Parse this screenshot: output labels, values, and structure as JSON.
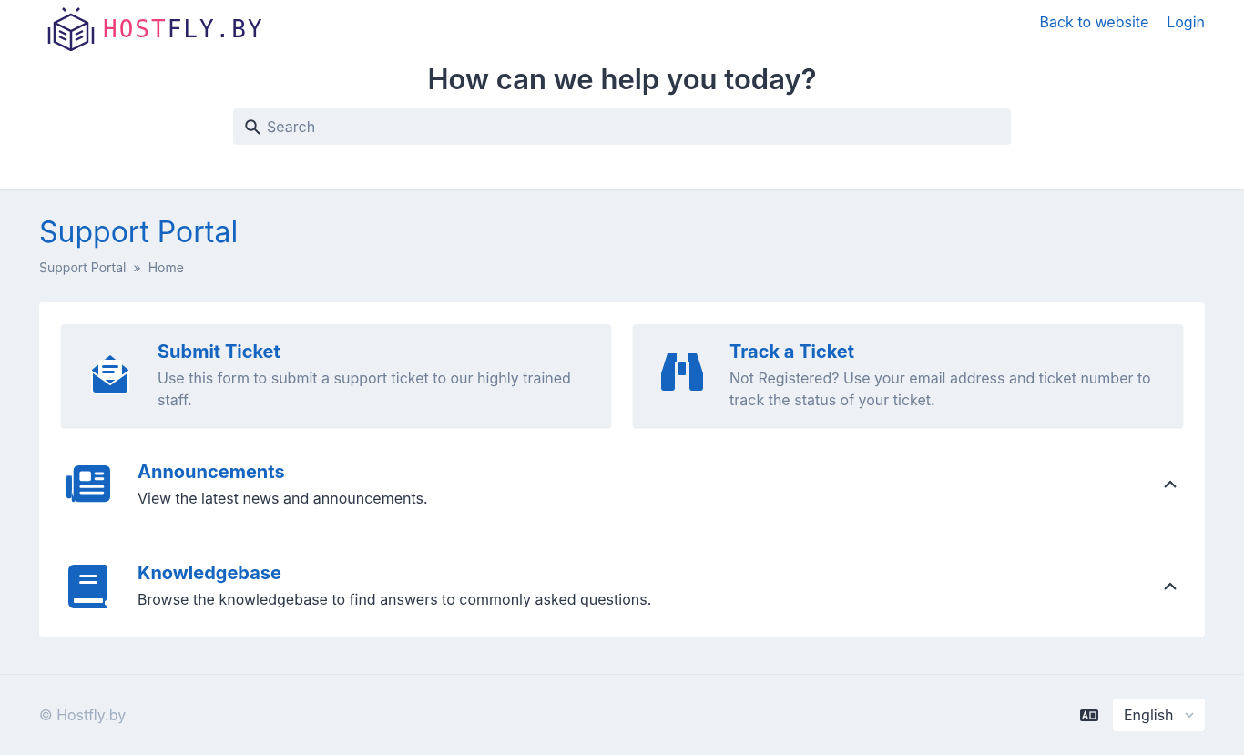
{
  "header": {
    "logo": {
      "part_1": "HOST",
      "part_2": "FLY.BY"
    },
    "nav": [
      "Back to website",
      "Login"
    ],
    "heading": "How can we help you today?",
    "search": {
      "placeholder": "Search"
    }
  },
  "page": {
    "title": "Support Portal",
    "breadcrumb": [
      {
        "label": "Support Portal"
      },
      {
        "label": "Home"
      }
    ],
    "breadcrumb_separator": "»"
  },
  "cards": [
    {
      "kind": "ticket",
      "title": "Submit Ticket",
      "description": "Use this form to submit a support ticket to our highly trained staff."
    },
    {
      "kind": "track",
      "title": "Track a Ticket",
      "description": "Not Registered? Use your email address and ticket number to track the status of your ticket."
    }
  ],
  "sections": [
    {
      "kind": "news",
      "title": "Announcements",
      "description": "View the latest news and announcements.",
      "expanded": true
    },
    {
      "kind": "book",
      "title": "Knowledgebase",
      "description": "Browse the knowledgebase to find answers to commonly asked questions.",
      "expanded": true
    }
  ],
  "footer": {
    "copyright": "© Hostfly.by",
    "language": "English"
  }
}
